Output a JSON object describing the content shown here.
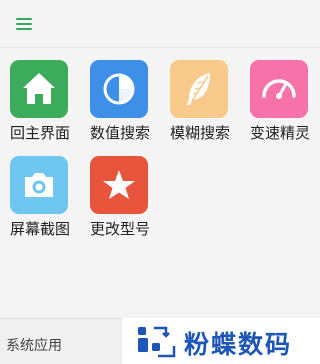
{
  "header": {
    "menu_icon": "hamburger-menu-icon"
  },
  "apps": [
    {
      "label": "回主界面",
      "icon": "home-icon",
      "color": "#3cac5c"
    },
    {
      "label": "数值搜索",
      "icon": "pie-chart-icon",
      "color": "#3d8fe8"
    },
    {
      "label": "模糊搜索",
      "icon": "feather-icon",
      "color": "#f7c98a"
    },
    {
      "label": "变速精灵",
      "icon": "speedometer-icon",
      "color": "#f772a8"
    },
    {
      "label": "屏幕截图",
      "icon": "camera-icon",
      "color": "#6fc6ef"
    },
    {
      "label": "更改型号",
      "icon": "star-icon",
      "color": "#e8553c"
    }
  ],
  "footer": {
    "label": "系统应用"
  },
  "watermark": {
    "text": "粉蝶数码"
  }
}
